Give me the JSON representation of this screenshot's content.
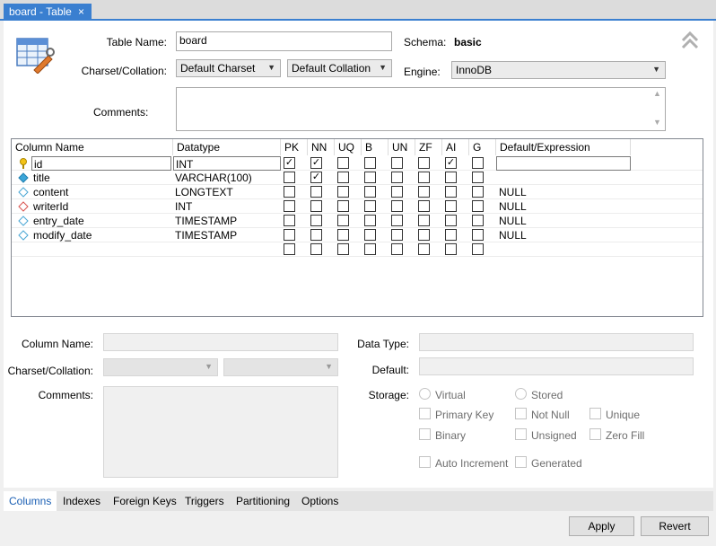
{
  "tab": {
    "title": "board - Table",
    "close": "×"
  },
  "header": {
    "table_name_label": "Table Name:",
    "table_name_value": "board",
    "schema_label": "Schema:",
    "schema_value": "basic",
    "charset_label": "Charset/Collation:",
    "charset_value": "Default Charset",
    "collation_value": "Default Collation",
    "engine_label": "Engine:",
    "engine_value": "InnoDB",
    "comments_label": "Comments:",
    "collapse_icon": "double-chevron-up-icon",
    "table_icon": "table-edit-icon"
  },
  "grid": {
    "headers": [
      "Column Name",
      "Datatype",
      "PK",
      "NN",
      "UQ",
      "B",
      "UN",
      "ZF",
      "AI",
      "G",
      "Default/Expression"
    ],
    "rows": [
      {
        "name": "id",
        "type": "INT",
        "default": "",
        "key": "pk"
      },
      {
        "name": "title",
        "type": "VARCHAR(100)",
        "default": "",
        "key": "nn"
      },
      {
        "name": "content",
        "type": "LONGTEXT",
        "default": "NULL",
        "key": "col"
      },
      {
        "name": "writerId",
        "type": "INT",
        "default": "NULL",
        "key": "fk"
      },
      {
        "name": "entry_date",
        "type": "TIMESTAMP",
        "default": "NULL",
        "key": "col"
      },
      {
        "name": "modify_date",
        "type": "TIMESTAMP",
        "default": "NULL",
        "key": "col"
      }
    ],
    "checked": {
      "id": [
        "PK",
        "NN",
        "AI"
      ],
      "title": [
        "NN"
      ]
    }
  },
  "details": {
    "column_name_label": "Column Name:",
    "charset_label": "Charset/Collation:",
    "comments_label": "Comments:",
    "data_type_label": "Data Type:",
    "default_label": "Default:",
    "storage_label": "Storage:",
    "virtual_label": "Virtual",
    "stored_label": "Stored",
    "primary_key_label": "Primary Key",
    "not_null_label": "Not Null",
    "unique_label": "Unique",
    "binary_label": "Binary",
    "unsigned_label": "Unsigned",
    "zero_fill_label": "Zero Fill",
    "auto_increment_label": "Auto Increment",
    "generated_label": "Generated"
  },
  "bottom_tabs": [
    "Columns",
    "Indexes",
    "Foreign Keys",
    "Triggers",
    "Partitioning",
    "Options"
  ],
  "buttons": {
    "apply": "Apply",
    "revert": "Revert"
  },
  "colors": {
    "accent": "#3a7fd0",
    "active_tab_text": "#1a5fb4"
  }
}
